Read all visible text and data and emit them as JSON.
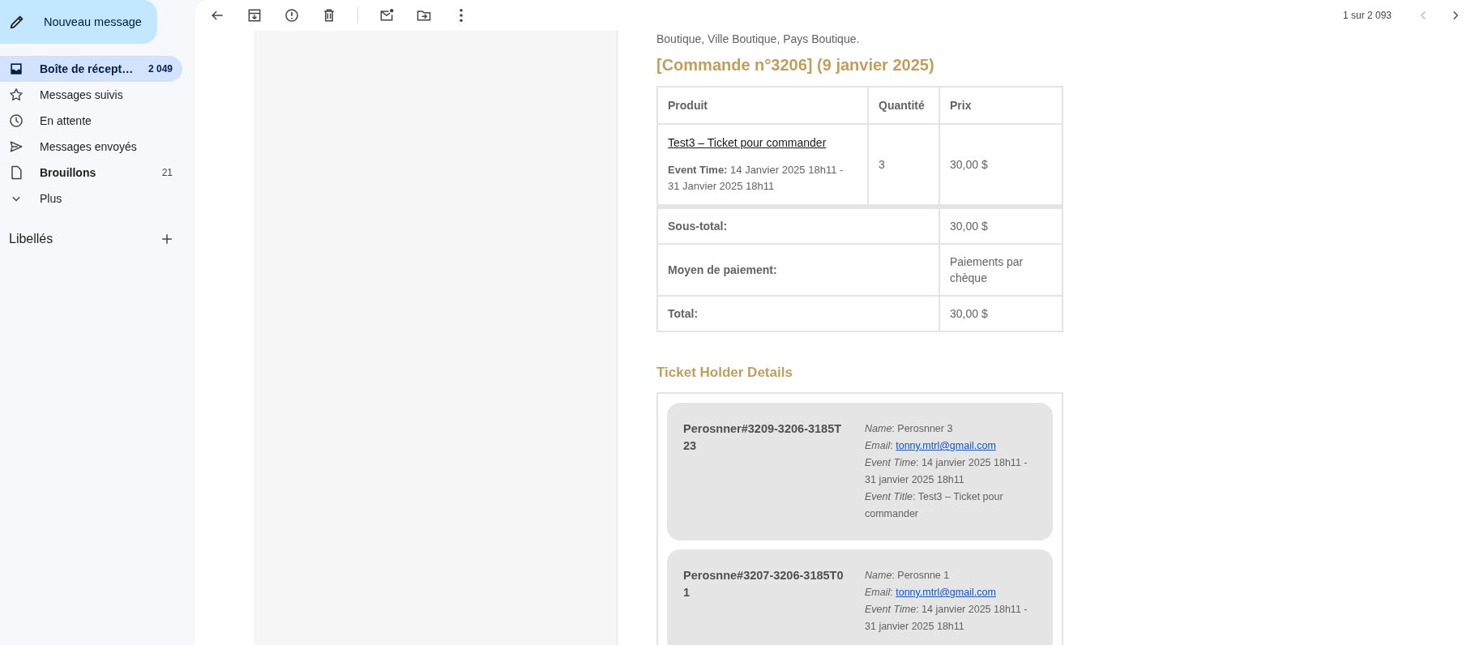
{
  "compose": {
    "label": "Nouveau message"
  },
  "sidebar": {
    "items": [
      {
        "kind": "inbox",
        "label": "Boîte de récept…",
        "count": "2 049",
        "selected": true,
        "unread": true
      },
      {
        "kind": "star",
        "label": "Messages suivis",
        "selected": false,
        "unread": false
      },
      {
        "kind": "clock",
        "label": "En attente",
        "selected": false,
        "unread": false
      },
      {
        "kind": "send",
        "label": "Messages envoyés",
        "selected": false,
        "unread": false
      },
      {
        "kind": "draft",
        "label": "Brouillons",
        "count": "21",
        "selected": false,
        "unread": true
      },
      {
        "kind": "chevron",
        "label": "Plus",
        "selected": false,
        "unread": false
      }
    ],
    "labels_heading": "Libellés"
  },
  "toolbar": {
    "pagination": "1 sur 2 093",
    "prev_disabled": true,
    "next_disabled": false
  },
  "email": {
    "address_tail": "Boutique, Ville Boutique, Pays Boutique.",
    "order_title": "[Commande n°3206] (9 janvier 2025)",
    "table": {
      "columns": [
        "Produit",
        "Quantité",
        "Prix"
      ],
      "items": [
        {
          "product": "Test3 – Ticket pour commander",
          "event": "**Event Time:** 14 Janvier 2025 18h11 - 31 Janvier 2025 18h11",
          "quantity": "3",
          "price": "30,00 $"
        }
      ],
      "totals": [
        {
          "label": "Sous-total:",
          "value": "30,00 $"
        },
        {
          "label": "Moyen de paiement:",
          "value": "Paiements par chèque"
        },
        {
          "label": "Total:",
          "value": "30,00 $"
        }
      ]
    },
    "holders_title": "Ticket Holder Details",
    "holders": [
      {
        "id": "Perosnner#3209-3206-3185T23",
        "fields": [
          {
            "kind": "text",
            "label": "*Name*:",
            "value": "Perosnner 3"
          },
          {
            "kind": "link",
            "label": "*Email*:",
            "value": "tonny.mtrl@gmail.com"
          },
          {
            "kind": "text",
            "label": "*Event Time*:",
            "value": "14 janvier 2025 18h11 - 31 janvier 2025 18h11"
          },
          {
            "kind": "text",
            "label": "*Event Title*:",
            "value": "Test3 – Ticket pour commander"
          }
        ]
      },
      {
        "id": "Perosnne#3207-3206-3185T01",
        "fields": [
          {
            "kind": "text",
            "label": "*Name*:",
            "value": "Perosnne 1"
          },
          {
            "kind": "link",
            "label": "*Email*:",
            "value": "tonny.mtrl@gmail.com"
          },
          {
            "kind": "text",
            "label": "*Event Time*:",
            "value": "14 janvier 2025 18h11 - 31 janvier 2025 18h11"
          }
        ]
      }
    ]
  }
}
